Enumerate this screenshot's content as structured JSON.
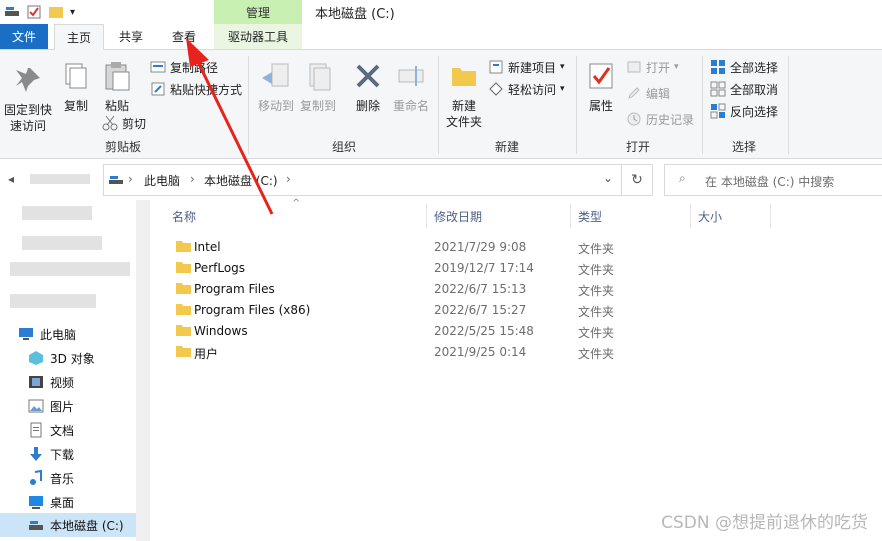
{
  "window": {
    "title": "本地磁盘 (C:)",
    "contextual_tab_group": "管理"
  },
  "tabs": {
    "file": "文件",
    "home": "主页",
    "share": "共享",
    "view": "查看",
    "drive_tools": "驱动器工具"
  },
  "ribbon": {
    "clipboard": {
      "label": "剪贴板",
      "pin_line1": "固定到快",
      "pin_line2": "速访问",
      "copy": "复制",
      "paste": "粘贴",
      "copy_path": "复制路径",
      "paste_shortcut": "粘贴快捷方式",
      "cut": "剪切"
    },
    "organize": {
      "label": "组织",
      "move_to": "移动到",
      "copy_to": "复制到",
      "delete": "删除",
      "rename": "重命名"
    },
    "new": {
      "label": "新建",
      "new_folder_line1": "新建",
      "new_folder_line2": "文件夹",
      "new_item": "新建项目",
      "easy_access": "轻松访问"
    },
    "open": {
      "label": "打开",
      "properties": "属性",
      "open": "打开",
      "edit": "编辑",
      "history": "历史记录"
    },
    "select": {
      "label": "选择",
      "select_all": "全部选择",
      "select_none": "全部取消",
      "invert": "反向选择"
    }
  },
  "address": {
    "crumbs": [
      "此电脑",
      "本地磁盘 (C:)"
    ]
  },
  "search": {
    "placeholder": "在 本地磁盘 (C:) 中搜索"
  },
  "navpane": {
    "items": [
      {
        "label": "此电脑",
        "icon": "computer-icon"
      },
      {
        "label": "3D 对象",
        "icon": "3d-objects-icon"
      },
      {
        "label": "视频",
        "icon": "video-icon"
      },
      {
        "label": "图片",
        "icon": "pictures-icon"
      },
      {
        "label": "文档",
        "icon": "documents-icon"
      },
      {
        "label": "下载",
        "icon": "download-icon"
      },
      {
        "label": "音乐",
        "icon": "music-icon"
      },
      {
        "label": "桌面",
        "icon": "desktop-icon"
      },
      {
        "label": "本地磁盘 (C:)",
        "icon": "drive-icon"
      }
    ]
  },
  "filelist": {
    "columns": {
      "name": "名称",
      "date": "修改日期",
      "type": "类型",
      "size": "大小"
    },
    "rows": [
      {
        "name": "Intel",
        "date": "2021/7/29 9:08",
        "type": "文件夹"
      },
      {
        "name": "PerfLogs",
        "date": "2019/12/7 17:14",
        "type": "文件夹"
      },
      {
        "name": "Program Files",
        "date": "2022/6/7 15:13",
        "type": "文件夹"
      },
      {
        "name": "Program Files (x86)",
        "date": "2022/6/7 15:27",
        "type": "文件夹"
      },
      {
        "name": "Windows",
        "date": "2022/5/25 15:48",
        "type": "文件夹"
      },
      {
        "name": "用户",
        "date": "2021/9/25 0:14",
        "type": "文件夹"
      }
    ]
  },
  "watermark": "CSDN @想提前退休的吃货",
  "colors": {
    "file_tab": "#1a6fc5",
    "manage_tab": "#c9f0b3",
    "annotation_arrow": "#e8231d",
    "folder": "#f2c94c"
  }
}
